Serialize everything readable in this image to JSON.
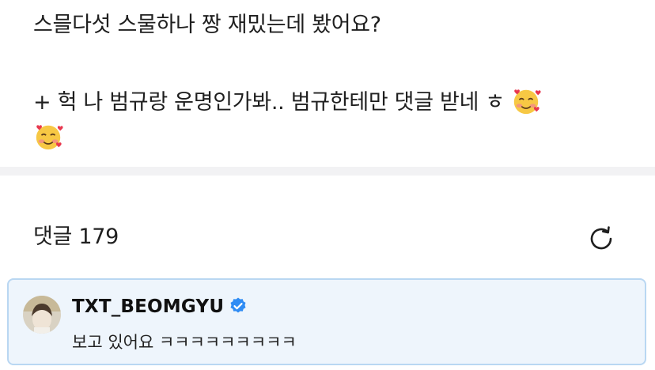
{
  "post": {
    "line1": "스믈다섯 스물하나 짱 재밌는데 봤어요?",
    "line2": "+ 헉 나 범규랑 운명인가봐.. 범규한테만 댓글 받네 ㅎ",
    "emoji": "smiling-face-with-hearts-icon"
  },
  "comments": {
    "header": "댓글 179",
    "refresh_icon": "refresh-icon",
    "items": [
      {
        "username": "TXT_BEOMGYU",
        "verified": true,
        "text": "보고 있어요 ㅋㅋㅋㅋㅋㅋㅋㅋㅋ"
      }
    ]
  },
  "colors": {
    "divider": "#f2f2f4",
    "highlight_bg": "#eef5fc",
    "highlight_border": "#b9d7f2",
    "verified": "#2f8cf4"
  }
}
